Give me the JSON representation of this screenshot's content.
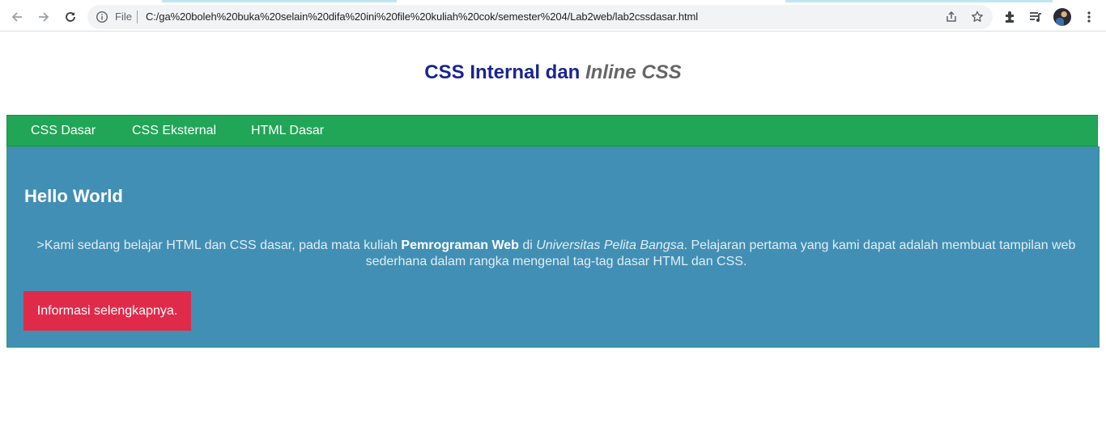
{
  "browser": {
    "file_label": "File",
    "url": "C:/ga%20boleh%20buka%20selain%20difa%20ini%20file%20kuliah%20cok/semester%204/Lab2web/lab2cssdasar.html",
    "icons": [
      "back-icon",
      "forward-icon",
      "reload-icon",
      "info-icon",
      "share-icon",
      "star-icon",
      "extensions-icon",
      "media-queue-icon",
      "profile-avatar",
      "menu-icon"
    ]
  },
  "page": {
    "title_main": "CSS Internal dan ",
    "title_italic": "Inline CSS",
    "nav": [
      "CSS Dasar",
      "CSS Eksternal",
      "HTML Dasar"
    ],
    "hero": {
      "heading": "Hello World",
      "text_1": ">Kami sedang belajar HTML dan CSS dasar, pada mata kuliah ",
      "text_bold": "Pemrograman Web",
      "text_2": " di ",
      "text_italic": "Universitas Pelita Bangsa",
      "text_3": ". Pelajaran pertama yang kami dapat adalah membuat tampilan web sederhana dalam rangka mengenal tag-tag dasar HTML dan CSS.",
      "button": "Informasi selengkapnya."
    }
  },
  "colors": {
    "title": "#1a2591",
    "navbar": "#21a657",
    "hero": "#418fb4",
    "button": "#e02a4a"
  }
}
